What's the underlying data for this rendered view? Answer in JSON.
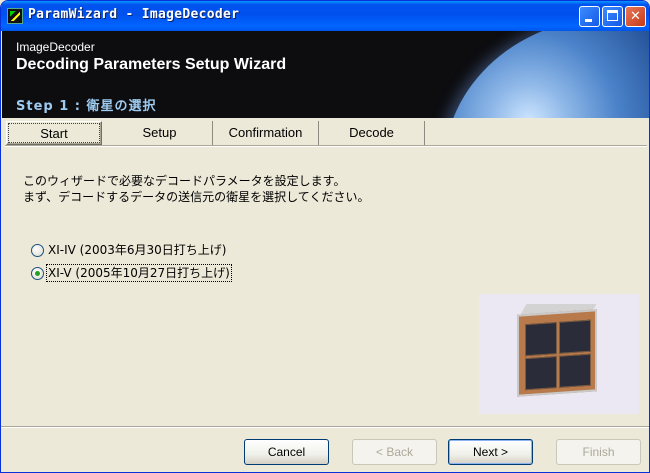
{
  "window": {
    "title": "ParamWizard - ImageDecoder"
  },
  "header": {
    "subtitle": "ImageDecoder",
    "title": "Decoding Parameters Setup Wizard",
    "step": "Step 1 : 衛星の選択"
  },
  "tabs": [
    {
      "label": "Start",
      "active": true
    },
    {
      "label": "Setup"
    },
    {
      "label": "Confirmation"
    },
    {
      "label": "Decode"
    }
  ],
  "description": {
    "line1": "このウィザードで必要なデコードパラメータを設定します。",
    "line2": "まず、デコードするデータの送信元の衛星を選択してください。"
  },
  "satellites": [
    {
      "label": "XI-IV (2003年6月30日打ち上げ)",
      "selected": false
    },
    {
      "label": "XI-V (2005年10月27日打ち上げ)",
      "selected": true
    }
  ],
  "buttons": {
    "cancel": "Cancel",
    "back": "< Back",
    "next": "Next >",
    "finish": "Finish"
  },
  "colors": {
    "titlebar": "#0053EE",
    "banner_bg": "#0d0d10",
    "step_text": "#9ecbf0",
    "radio_dot": "#21a121"
  }
}
